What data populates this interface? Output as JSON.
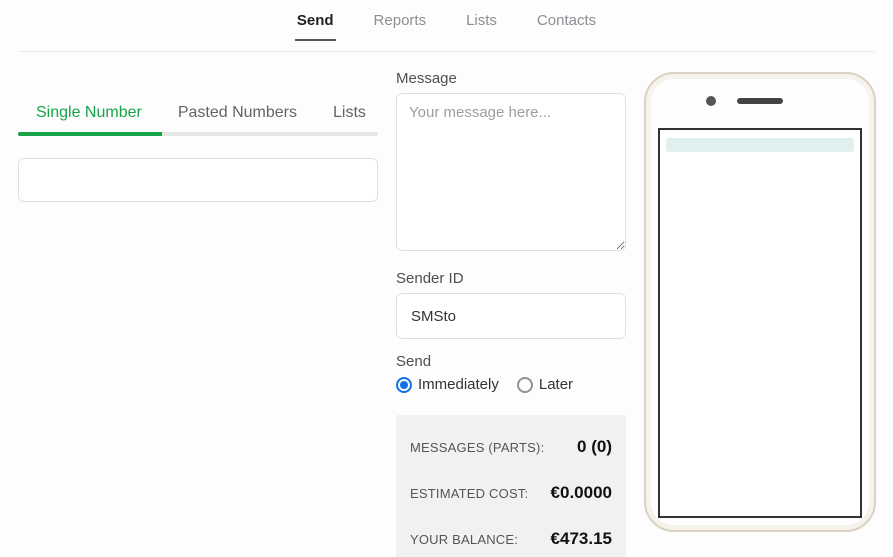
{
  "topnav": {
    "items": [
      {
        "label": "Send",
        "active": true
      },
      {
        "label": "Reports",
        "active": false
      },
      {
        "label": "Lists",
        "active": false
      },
      {
        "label": "Contacts",
        "active": false
      }
    ]
  },
  "recipients": {
    "tabs": [
      {
        "label": "Single Number",
        "active": true
      },
      {
        "label": "Pasted Numbers",
        "active": false
      },
      {
        "label": "Lists",
        "active": false
      }
    ],
    "number_value": ""
  },
  "message": {
    "label": "Message",
    "placeholder": "Your message here...",
    "value": ""
  },
  "sender": {
    "label": "Sender ID",
    "value": "SMSto"
  },
  "send_when": {
    "label": "Send",
    "options": {
      "immediately": "Immediately",
      "later": "Later"
    },
    "selected": "immediately"
  },
  "summary": {
    "messages_parts_label": "MESSAGES (PARTS):",
    "messages_parts_value": "0 (0)",
    "estimated_cost_label": "ESTIMATED COST:",
    "estimated_cost_value": "€0.0000",
    "your_balance_label": "YOUR BALANCE:",
    "your_balance_value": "€473.15"
  }
}
